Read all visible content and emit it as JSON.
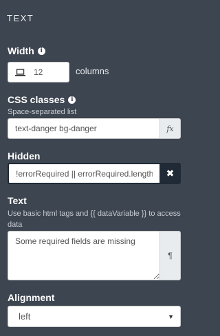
{
  "panel": {
    "title": "TEXT"
  },
  "width": {
    "label": "Width",
    "value": "12",
    "unit_label": "columns",
    "device_icon": "laptop-icon"
  },
  "css_classes": {
    "label": "CSS classes",
    "help": "Space-separated list",
    "value": "text-danger bg-danger",
    "addon_label": "fx"
  },
  "hidden": {
    "label": "Hidden",
    "value": "!errorRequired || errorRequired.length",
    "clear_label": "✖"
  },
  "text": {
    "label": "Text",
    "help": "Use basic html tags and {{ dataVariable }} to access data",
    "value": "Some required fields are missing",
    "addon_label": "¶"
  },
  "alignment": {
    "label": "Alignment",
    "selected": "left"
  },
  "colors": {
    "panel_bg": "#3d4550",
    "addon_dark": "#1f2a36"
  }
}
